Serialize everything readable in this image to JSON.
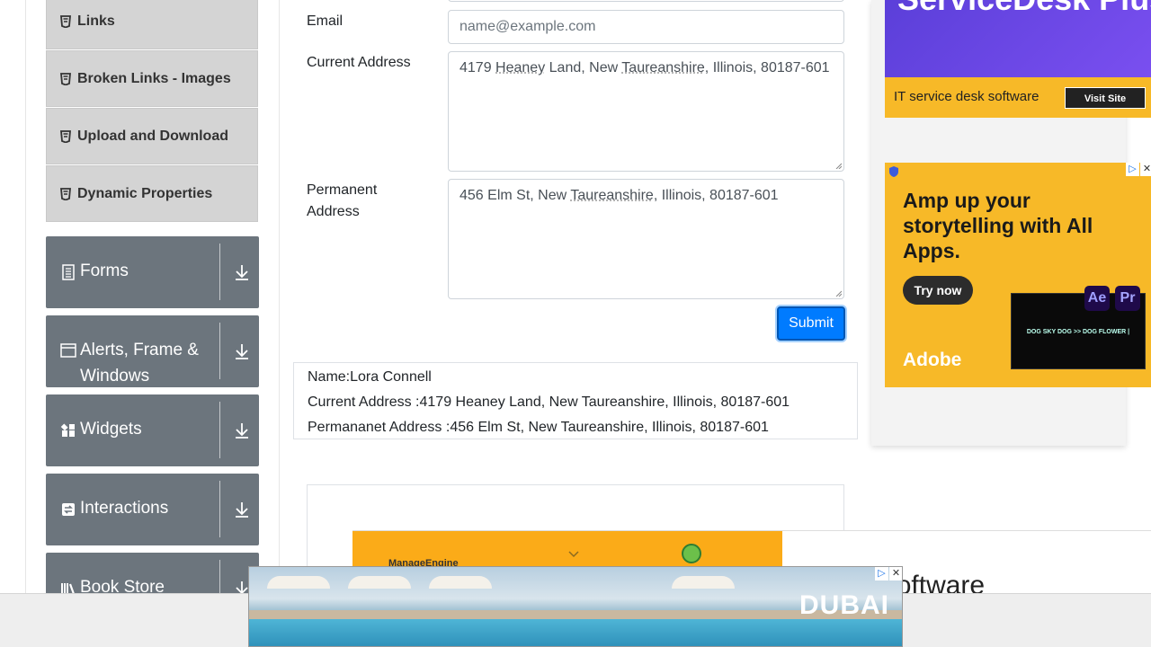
{
  "sidebar": {
    "sub_items": [
      {
        "label": "Links"
      },
      {
        "label": "Broken Links - Images"
      },
      {
        "label": "Upload and Download"
      },
      {
        "label": "Dynamic Properties"
      }
    ],
    "groups": [
      {
        "label": "Forms",
        "icon": "form-icon"
      },
      {
        "label": "Alerts, Frame & Windows",
        "icon": "window-icon"
      },
      {
        "label": "Widgets",
        "icon": "widgets-icon"
      },
      {
        "label": "Interactions",
        "icon": "interactions-icon"
      },
      {
        "label": "Book Store Application",
        "icon": "book-store-icon"
      }
    ]
  },
  "form": {
    "email_label": "Email",
    "email_placeholder": "name@example.com",
    "current_address_label": "Current Address",
    "current_address": {
      "pre": "4179 ",
      "w1": "Heaney",
      "mid": " Land, New ",
      "w2": "Taureanshire",
      "post": ", Illinois, 80187-601"
    },
    "permanent_address_label": "Permanent Address",
    "permanent_address": {
      "pre": "456 Elm St, New ",
      "w1": "Taureanshire",
      "post": ", Illinois, 80187-601"
    },
    "submit_label": "Submit"
  },
  "output": {
    "name": "Name:Lora Connell",
    "current_address": "Current Address :4179 Heaney Land, New Taureanshire, Illinois, 80187-601",
    "permanent_address": "Permananet Address :456 Elm St, New Taureanshire, Illinois, 80187-601"
  },
  "ads": {
    "top": {
      "headline": "ServiceDesk Plus",
      "tagline": "IT service desk software",
      "cta": "Visit Site"
    },
    "adobe": {
      "headline": "Amp up your storytelling with All Apps.",
      "cta": "Try now",
      "brand": "Adobe",
      "ae": "Ae",
      "pr": "Pr",
      "screen_text": "DOG SKY DOG >> DOG FLOWER |"
    },
    "banner": {
      "brand": "ManageEngine",
      "text": "ce desk software"
    },
    "dubai": {
      "brand": "DUBAI"
    },
    "ad_choice_symbols": [
      "▷",
      "✕"
    ]
  },
  "colors": {
    "primary": "#007bff",
    "sidebar_group": "#6c757d",
    "sub_item": "#d4d4d4",
    "ad_yellow": "#f7b928"
  }
}
